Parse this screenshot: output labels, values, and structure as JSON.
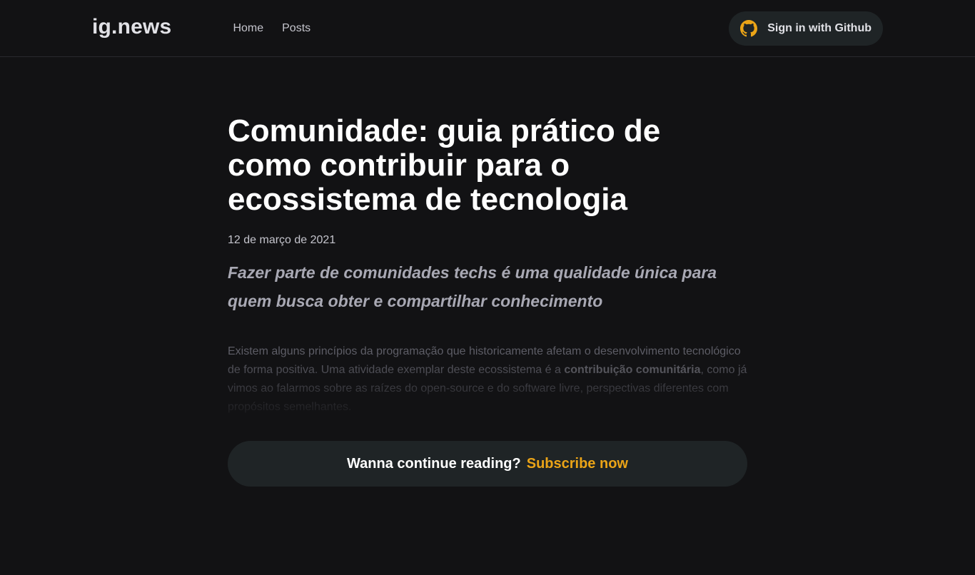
{
  "header": {
    "logo": "ig.news",
    "nav": [
      {
        "label": "Home"
      },
      {
        "label": "Posts"
      }
    ],
    "signin_label": "Sign in with Github",
    "github_icon_color": "#eba417"
  },
  "article": {
    "title": "Comunidade: guia prático de como contribuir para o ecossistema de tecnologia",
    "date": "12 de março de 2021",
    "lead": "Fazer parte de comunidades techs é uma qualidade única para quem busca obter e compartilhar conhecimento",
    "preview_before": "Existem alguns princípios da programação que historicamente afetam o desenvolvimento tecnológico de forma positiva. Uma atividade exemplar deste ecossistema é a ",
    "preview_bold": "contribuição comunitária",
    "preview_after": ", como já vimos ao falarmos sobre as raízes do open-source e do software livre, perspectivas diferentes com propósitos semelhantes."
  },
  "cta": {
    "text": "Wanna continue reading?",
    "link": "Subscribe now",
    "accent": "#eba417"
  }
}
